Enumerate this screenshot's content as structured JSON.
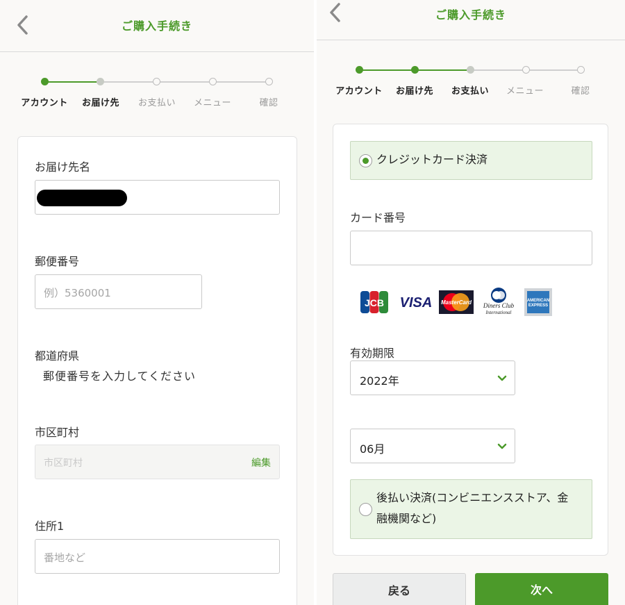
{
  "left": {
    "header": {
      "title": "ご購入手続き"
    },
    "steps": [
      {
        "label": "アカウント",
        "state": "done"
      },
      {
        "label": "お届け先",
        "state": "current"
      },
      {
        "label": "お支払い",
        "state": "todo"
      },
      {
        "label": "メニュー",
        "state": "todo"
      },
      {
        "label": "確認",
        "state": "todo"
      }
    ],
    "form": {
      "name_label": "お届け先名",
      "postal_label": "郵便番号",
      "postal_placeholder": "例）5360001",
      "prefecture_label": "都道府県",
      "prefecture_value": "郵便番号を入力してください",
      "city_label": "市区町村",
      "city_placeholder": "市区町村",
      "city_edit": "編集",
      "address1_label": "住所1",
      "address1_placeholder": "番地など"
    }
  },
  "right": {
    "header": {
      "title": "ご購入手続き"
    },
    "steps": [
      {
        "label": "アカウント",
        "state": "done"
      },
      {
        "label": "お届け先",
        "state": "done"
      },
      {
        "label": "お支払い",
        "state": "current"
      },
      {
        "label": "メニュー",
        "state": "todo"
      },
      {
        "label": "確認",
        "state": "todo"
      }
    ],
    "payment": {
      "credit_label": "クレジットカード決済",
      "card_number_label": "カード番号",
      "brands": [
        "JCB",
        "VISA",
        "MasterCard",
        "Diners Club International",
        "AMERICAN EXPRESS"
      ],
      "expiry_label": "有効期限",
      "year_value": "2022年",
      "month_value": "06月",
      "deferred_label_1": "後払い決済(コンビニエンスストア、金",
      "deferred_label_2": "融機関など)"
    },
    "buttons": {
      "back": "戻る",
      "next": "次へ"
    }
  },
  "colors": {
    "accent": "#4c9a2a",
    "selected_bg": "#ebf5e6"
  }
}
